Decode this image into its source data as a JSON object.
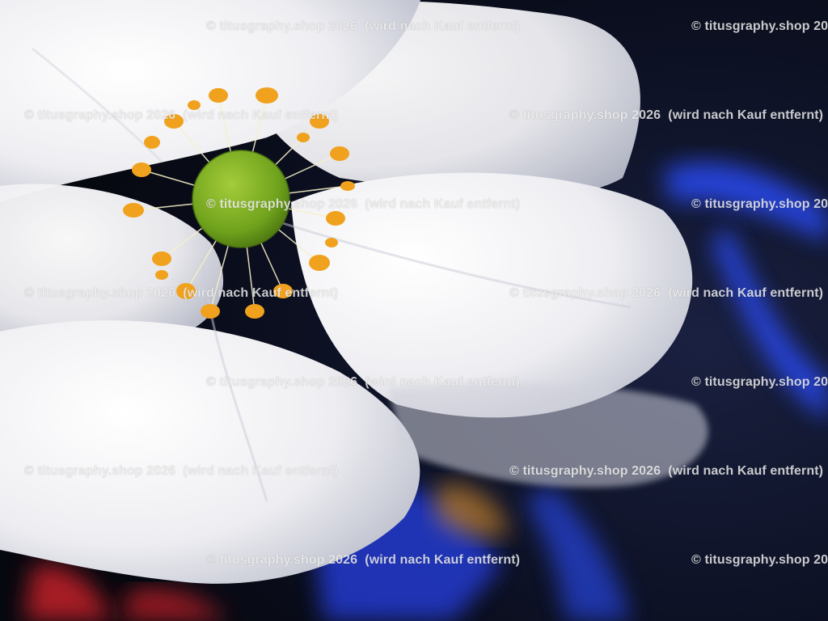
{
  "photo": {
    "subject": "white anemone flower with yellow stamens and green center",
    "colors": {
      "petal": "#f2f2f4",
      "petal_shadow": "#b9bccb",
      "stamen": "#f0a21e",
      "pistil": "#6fa21c",
      "background_dark": "#0a0d18",
      "light_blue": "#2b4dff",
      "light_red": "#d0202a"
    }
  },
  "watermark": {
    "symbol": "©",
    "text": "titusgraphy.shop 2026",
    "note": "(wird nach Kauf entfernt)"
  }
}
